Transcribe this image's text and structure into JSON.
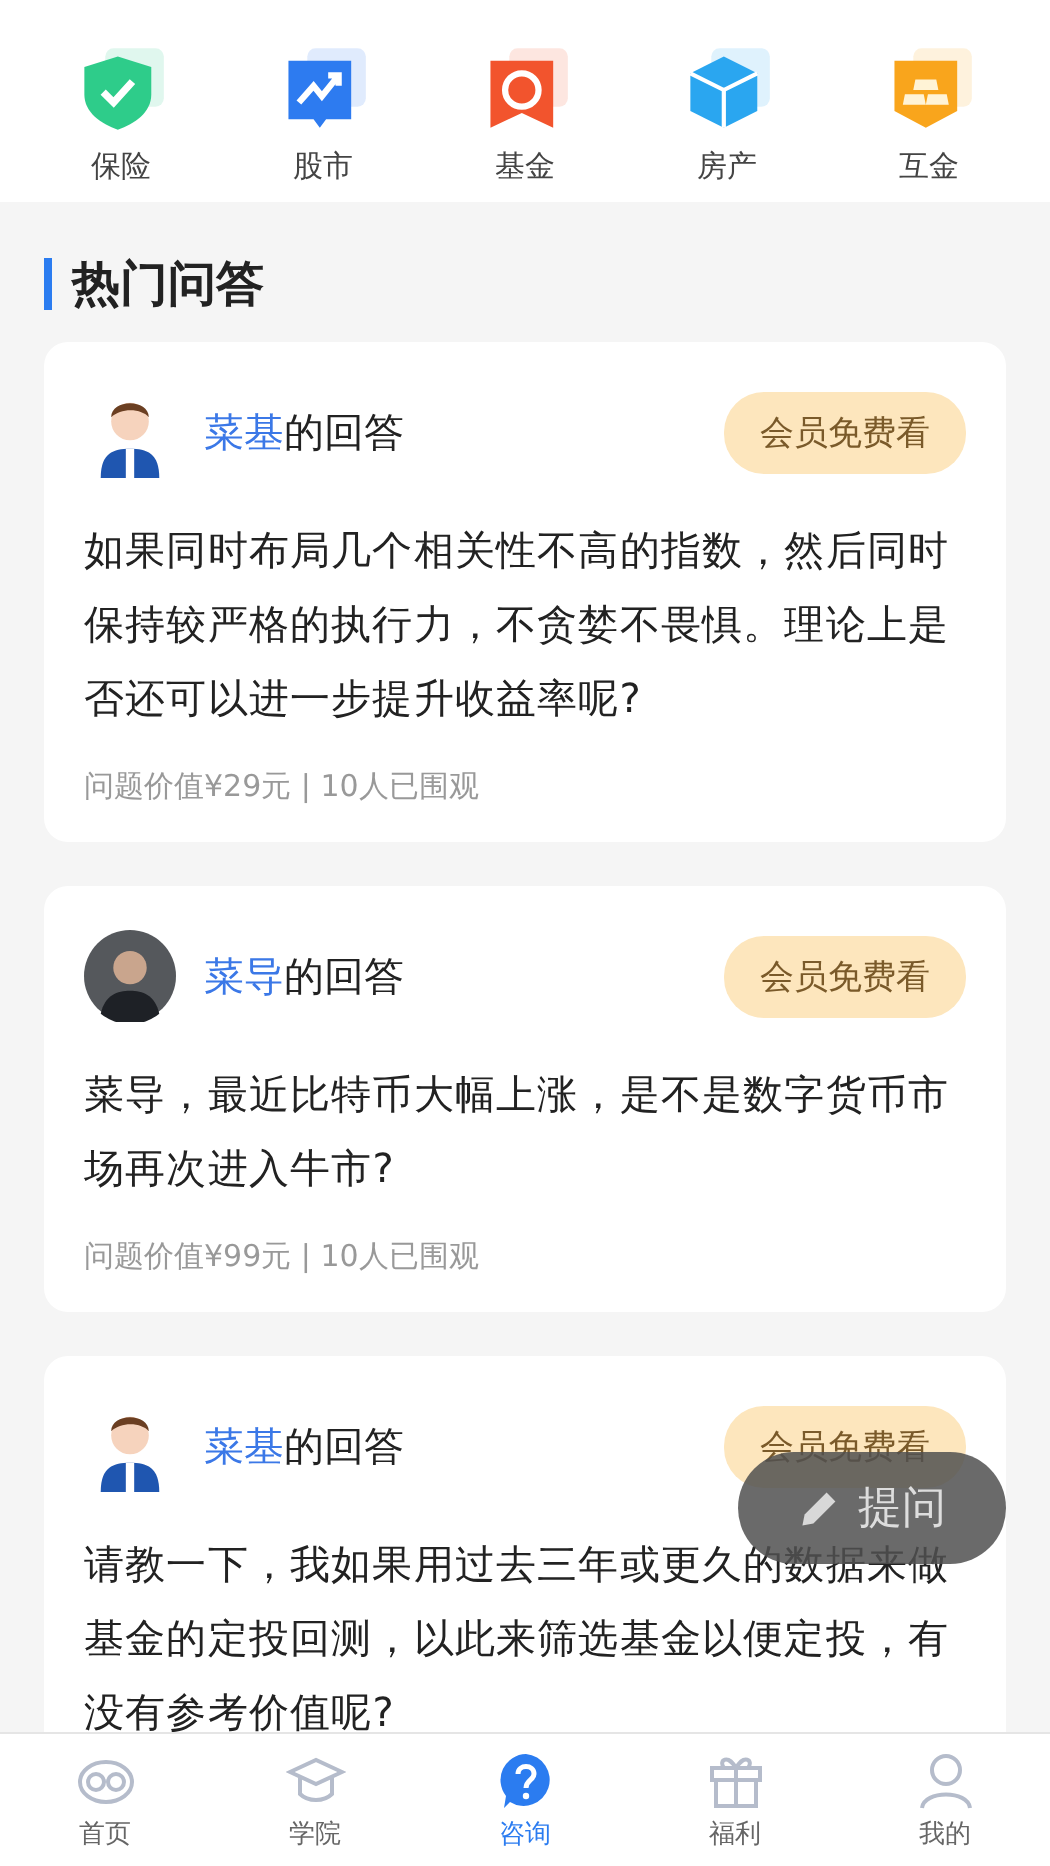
{
  "categories": [
    {
      "label": "保险",
      "kind": "shield"
    },
    {
      "label": "股市",
      "kind": "chart"
    },
    {
      "label": "基金",
      "kind": "fund"
    },
    {
      "label": "房产",
      "kind": "house"
    },
    {
      "label": "互金",
      "kind": "gold"
    }
  ],
  "section_title": "热门问答",
  "questions": [
    {
      "avatar": {
        "kind": "cartoon"
      },
      "name": "菜基",
      "suffix": "的回答",
      "badge": "会员免费看",
      "text": "如果同时布局几个相关性不高的指数，然后同时保持较严格的执行力，不贪婪不畏惧。理论上是否还可以进一步提升收益率呢?",
      "meta": "问题价值¥29元 | 10人已围观"
    },
    {
      "avatar": {
        "kind": "photo"
      },
      "name": "菜导",
      "suffix": "的回答",
      "badge": "会员免费看",
      "text": "菜导，最近比特币大幅上涨，是不是数字货币市场再次进入牛市?",
      "meta": "问题价值¥99元 | 10人已围观"
    },
    {
      "avatar": {
        "kind": "cartoon"
      },
      "name": "菜基",
      "suffix": "的回答",
      "badge": "会员免费看",
      "text": "请教一下，我如果用过去三年或更久的数据来做基金的定投回测，以此来筛选基金以便定投，有没有参考价值呢?"
    }
  ],
  "ask_button": "提问",
  "tabs": [
    {
      "label": "首页",
      "kind": "owl",
      "selected": false
    },
    {
      "label": "学院",
      "kind": "cap",
      "selected": false
    },
    {
      "label": "咨询",
      "kind": "ask",
      "selected": true
    },
    {
      "label": "福利",
      "kind": "gift",
      "selected": false
    },
    {
      "label": "我的",
      "kind": "user",
      "selected": false
    }
  ]
}
